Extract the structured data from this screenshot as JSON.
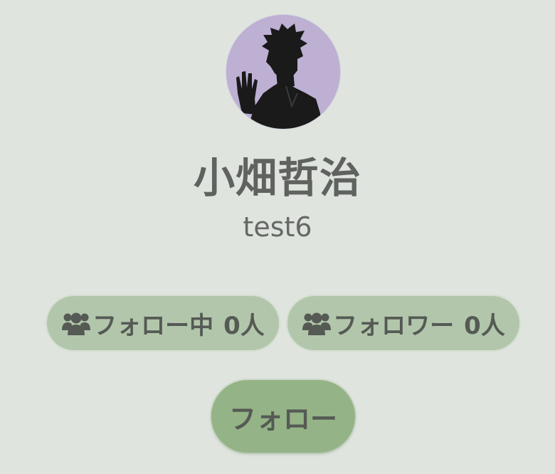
{
  "profile": {
    "display_name": "小畑哲治",
    "username": "test6",
    "avatar_bg": "#bdb0d3"
  },
  "stats": {
    "following_label": "フォロー中",
    "following_count": "0人",
    "followers_label": "フォロワー",
    "followers_count": "0人",
    "icon": "users-icon"
  },
  "actions": {
    "follow_label": "フォロー"
  },
  "colors": {
    "background": "#dfe4de",
    "pill": "#b2c6ab",
    "button": "#94b386",
    "text": "#5f625f"
  }
}
